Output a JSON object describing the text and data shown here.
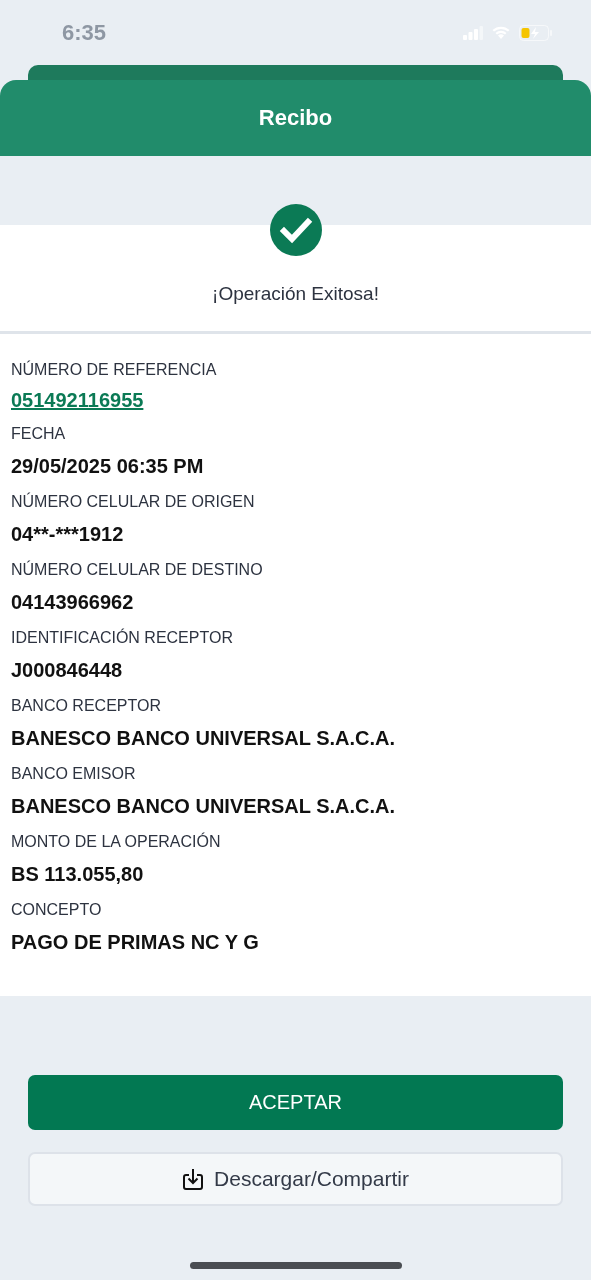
{
  "status_bar": {
    "time": "6:35"
  },
  "header": {
    "title": "Recibo"
  },
  "result": {
    "message": "¡Operación Exitosa!"
  },
  "fields": [
    {
      "label": "NÚMERO DE REFERENCIA",
      "value": "051492116955",
      "kind": "link"
    },
    {
      "label": "FECHA",
      "value": "29/05/2025 06:35 PM",
      "kind": "text"
    },
    {
      "label": "NÚMERO CELULAR DE ORIGEN",
      "value": "04**-***1912",
      "kind": "text"
    },
    {
      "label": "NÚMERO CELULAR DE DESTINO",
      "value": "04143966962",
      "kind": "text"
    },
    {
      "label": "IDENTIFICACIÓN RECEPTOR",
      "value": "J000846448",
      "kind": "text"
    },
    {
      "label": "BANCO RECEPTOR",
      "value": "BANESCO BANCO UNIVERSAL S.A.C.A.",
      "kind": "text"
    },
    {
      "label": "BANCO EMISOR",
      "value": "BANESCO BANCO UNIVERSAL S.A.C.A.",
      "kind": "text"
    },
    {
      "label": "MONTO DE LA OPERACIÓN",
      "value": "BS 113.055,80",
      "kind": "text"
    },
    {
      "label": "CONCEPTO",
      "value": "PAGO DE PRIMAS NC Y G",
      "kind": "text"
    }
  ],
  "buttons": [
    {
      "label": "ACEPTAR",
      "kind": "primary"
    },
    {
      "label": "Descargar/Compartir",
      "kind": "secondary"
    }
  ]
}
